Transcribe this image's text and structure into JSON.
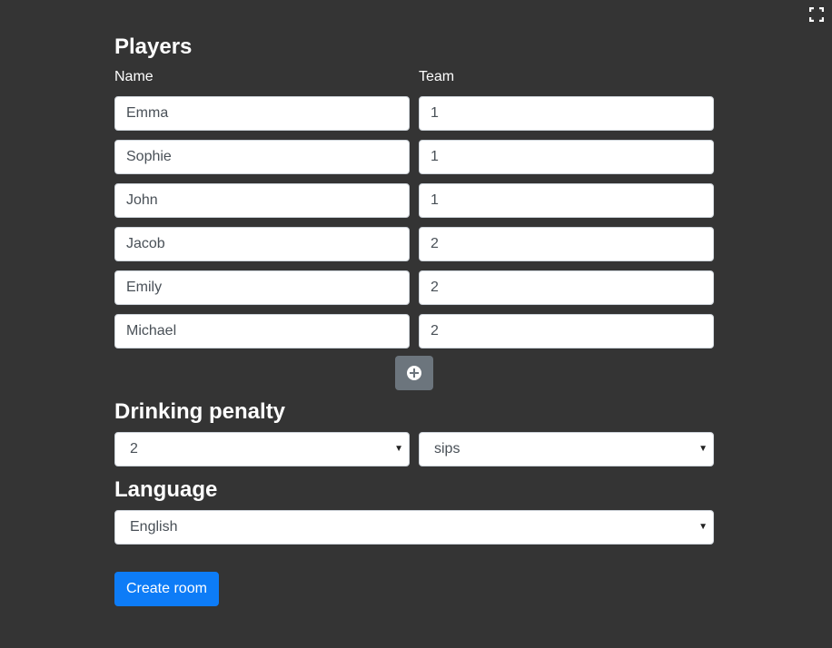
{
  "fullscreen_icon": "expand-icon",
  "players": {
    "title": "Players",
    "name_label": "Name",
    "team_label": "Team",
    "rows": [
      {
        "name": "Emma",
        "team": "1"
      },
      {
        "name": "Sophie",
        "team": "1"
      },
      {
        "name": "John",
        "team": "1"
      },
      {
        "name": "Jacob",
        "team": "2"
      },
      {
        "name": "Emily",
        "team": "2"
      },
      {
        "name": "Michael",
        "team": "2"
      }
    ],
    "add_icon": "plus-circle-icon"
  },
  "penalty": {
    "title": "Drinking penalty",
    "amount": "2",
    "unit": "sips"
  },
  "language": {
    "title": "Language",
    "selected": "English"
  },
  "actions": {
    "create_label": "Create room"
  },
  "colors": {
    "background": "#343434",
    "primary": "#0d7cf7",
    "secondary": "#6c757d"
  }
}
